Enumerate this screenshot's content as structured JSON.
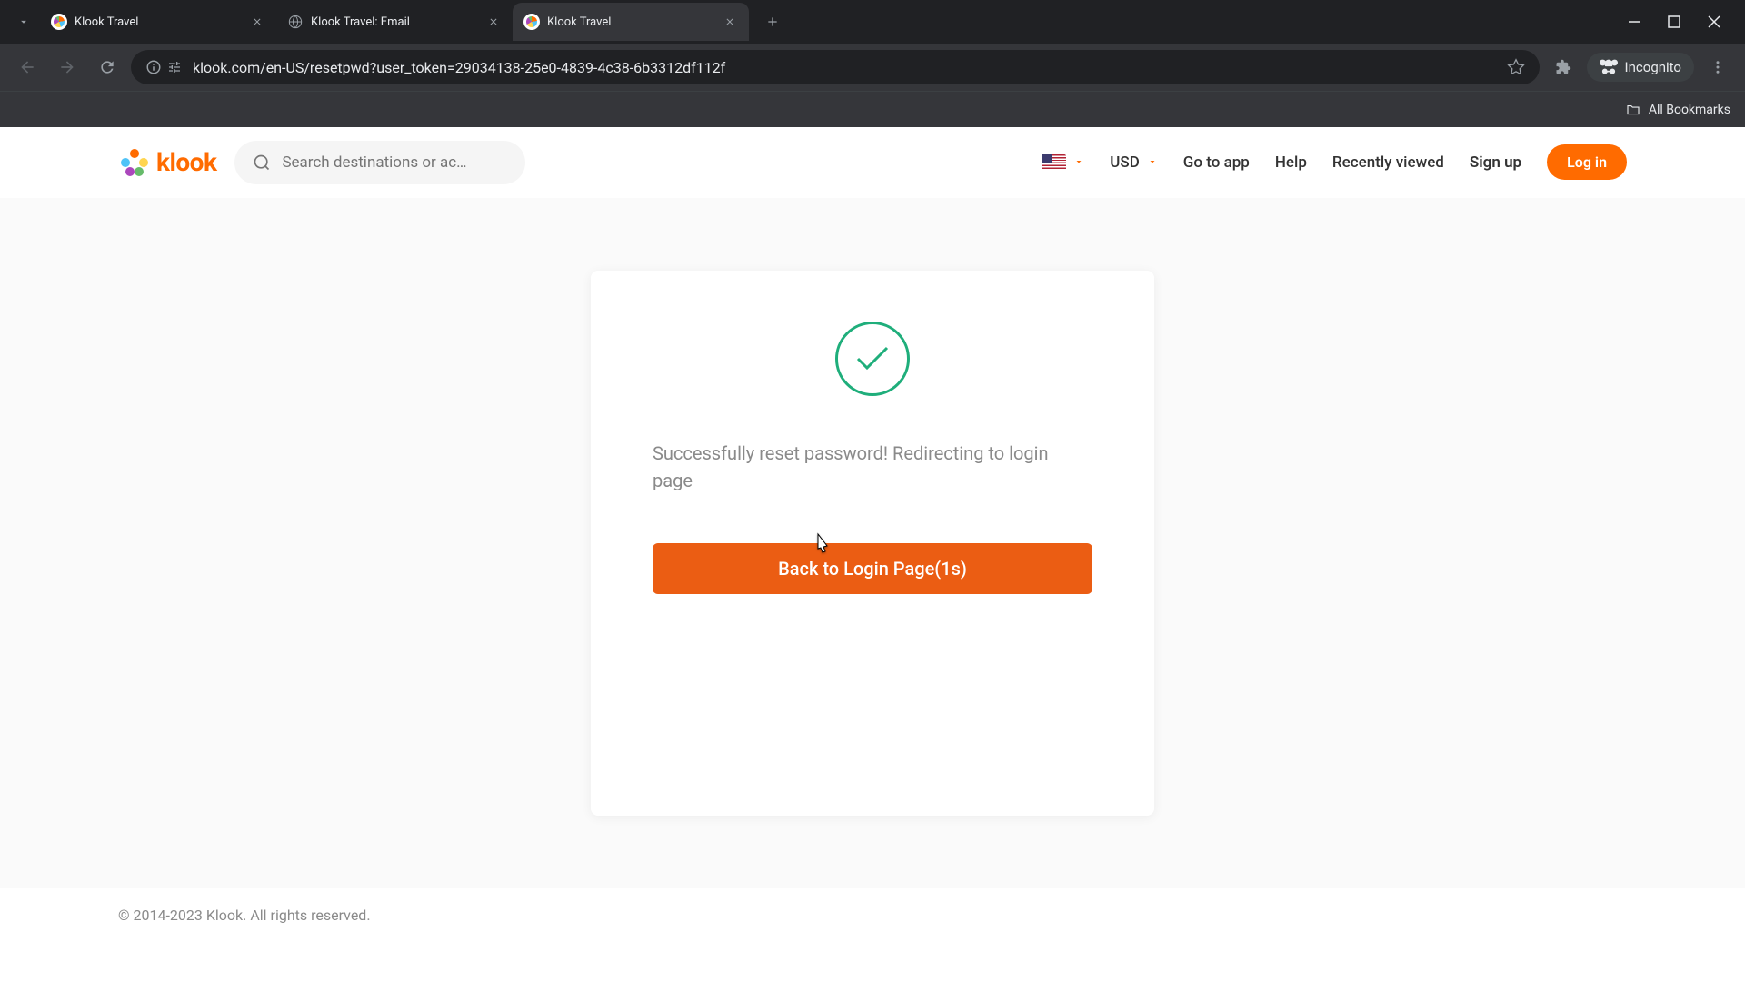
{
  "browser": {
    "tabs": [
      {
        "title": "Klook Travel",
        "active": false,
        "favicon": "klook"
      },
      {
        "title": "Klook Travel: Email",
        "active": false,
        "favicon": "globe"
      },
      {
        "title": "Klook Travel",
        "active": true,
        "favicon": "klook"
      }
    ],
    "url_display": "klook.com/en-US/resetpwd?user_token=29034138-25e0-4839-4c38-6b3312df112f",
    "incognito_label": "Incognito",
    "all_bookmarks": "All Bookmarks"
  },
  "header": {
    "logo_text": "klook",
    "search_placeholder": "Search destinations or ac…",
    "currency": "USD",
    "go_to_app": "Go to app",
    "help": "Help",
    "recently_viewed": "Recently viewed",
    "sign_up": "Sign up",
    "log_in": "Log in"
  },
  "content": {
    "success_message": "Successfully reset password! Redirecting to login page",
    "back_button": "Back to Login Page(1s)"
  },
  "footer": {
    "copyright": "© 2014-2023 Klook. All rights reserved."
  }
}
